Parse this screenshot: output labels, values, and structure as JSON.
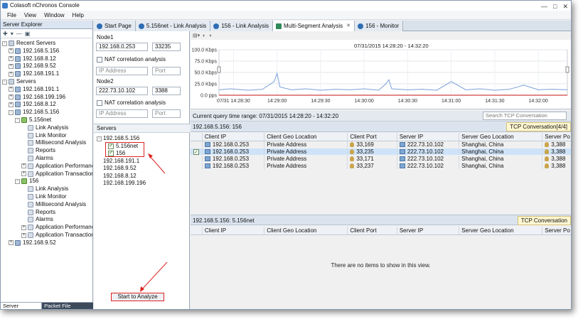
{
  "app": {
    "title": "Colasoft nChronos Console"
  },
  "menu": [
    "File",
    "View",
    "Window",
    "Help"
  ],
  "sidebar": {
    "title": "Server Explorer",
    "tree": [
      {
        "label": "Recent Servers",
        "level": 0,
        "icon": "folder-icon",
        "exp": "-"
      },
      {
        "label": "192.168.5.156",
        "level": 1,
        "icon": "server-icon",
        "exp": "+"
      },
      {
        "label": "192.168.8.12",
        "level": 1,
        "icon": "server-icon",
        "exp": "+"
      },
      {
        "label": "192.168.9.52",
        "level": 1,
        "icon": "server-icon",
        "exp": "+"
      },
      {
        "label": "192.168.191.1",
        "level": 1,
        "icon": "server-icon",
        "exp": "+"
      },
      {
        "label": "Servers",
        "level": 0,
        "icon": "folder-icon",
        "exp": "-"
      },
      {
        "label": "192.168.191.1",
        "level": 1,
        "icon": "server-icon",
        "exp": "+"
      },
      {
        "label": "192.168.199.196",
        "level": 1,
        "icon": "server-icon",
        "exp": "+"
      },
      {
        "label": "192.168.8.12",
        "level": 1,
        "icon": "server-icon",
        "exp": "+"
      },
      {
        "label": "192.168.5.156",
        "level": 1,
        "icon": "server-icon",
        "exp": "-"
      },
      {
        "label": "5.156net",
        "level": 2,
        "icon": "network-icon",
        "exp": "-"
      },
      {
        "label": "Link Analysis",
        "level": 3,
        "icon": "function-icon",
        "exp": ""
      },
      {
        "label": "Link Monitor",
        "level": 3,
        "icon": "function-icon",
        "exp": ""
      },
      {
        "label": "Millisecond Analysis",
        "level": 3,
        "icon": "function-icon",
        "exp": ""
      },
      {
        "label": "Reports",
        "level": 3,
        "icon": "function-icon",
        "exp": ""
      },
      {
        "label": "Alarms",
        "level": 3,
        "icon": "function-icon",
        "exp": ""
      },
      {
        "label": "Application Performance",
        "level": 3,
        "icon": "function-icon",
        "exp": "+"
      },
      {
        "label": "Application Transaction A",
        "level": 3,
        "icon": "function-icon",
        "exp": "+"
      },
      {
        "label": "156",
        "level": 2,
        "icon": "network-icon",
        "exp": "-"
      },
      {
        "label": "Link Analysis",
        "level": 3,
        "icon": "function-icon",
        "exp": ""
      },
      {
        "label": "Link Monitor",
        "level": 3,
        "icon": "function-icon",
        "exp": ""
      },
      {
        "label": "Millisecond Analysis",
        "level": 3,
        "icon": "function-icon",
        "exp": ""
      },
      {
        "label": "Reports",
        "level": 3,
        "icon": "function-icon",
        "exp": ""
      },
      {
        "label": "Alarms",
        "level": 3,
        "icon": "function-icon",
        "exp": ""
      },
      {
        "label": "Application Performance",
        "level": 3,
        "icon": "function-icon",
        "exp": "+"
      },
      {
        "label": "Application Transaction A",
        "level": 3,
        "icon": "function-icon",
        "exp": "+"
      },
      {
        "label": "192.168.9.52",
        "level": 1,
        "icon": "server-icon",
        "exp": "+"
      }
    ],
    "bottom_tabs": [
      "Server Explorer",
      "Packet File Explorer"
    ]
  },
  "tabs": [
    {
      "label": "Start Page",
      "active": false,
      "closable": false
    },
    {
      "label": "5.156net - Link Analysis",
      "active": false,
      "closable": false
    },
    {
      "label": "156 - Link Analysis",
      "active": false,
      "closable": false
    },
    {
      "label": "Multi-Segment Analysis",
      "active": true,
      "closable": true
    },
    {
      "label": "156 - Monitor",
      "active": false,
      "closable": false
    }
  ],
  "nodes": {
    "node1_label": "Node1",
    "node1_ip": "192.168.0.253",
    "node1_port": "33235",
    "node2_label": "Node2",
    "node2_ip": "222.73.10.102",
    "node2_port": "3388",
    "nat_label": "NAT correlation analysis",
    "ip_placeholder": "IP Address",
    "port_placeholder": "Port"
  },
  "servers_panel": {
    "title": "Servers",
    "items": [
      {
        "label": "192.168.5.156",
        "level": 0,
        "exp": "-",
        "checked": null
      },
      {
        "label": "5.156net",
        "level": 1,
        "exp": "",
        "checked": true
      },
      {
        "label": "156",
        "level": 1,
        "exp": "",
        "checked": true
      },
      {
        "label": "192.168.191.1",
        "level": 0,
        "exp": "",
        "checked": null
      },
      {
        "label": "192.168.9.52",
        "level": 0,
        "exp": "",
        "checked": null
      },
      {
        "label": "192.168.8.12",
        "level": 0,
        "exp": "",
        "checked": null
      },
      {
        "label": "192.168.199.196",
        "level": 0,
        "exp": "",
        "checked": null
      }
    ],
    "analyze_button": "Start to Analyze"
  },
  "chart_data": {
    "type": "line",
    "title": "07/31/2015  14:28:20 - 14:32:20",
    "y_ticks": [
      "100.0 Kbps",
      "75.0 Kbps",
      "50.0 Kbps",
      "25.0 Kbps",
      "0.0 pps"
    ],
    "x_ticks": [
      "07/31 14:28:30",
      "14:29:00",
      "14:29:30",
      "14:30:00",
      "14:30:30",
      "14:31:00",
      "14:31:30",
      "14:32:00"
    ],
    "ylim": [
      0,
      100
    ],
    "x_seconds_range": [
      0,
      240
    ],
    "series": [
      {
        "name": "192.168.5.156: 156",
        "color": "#7aa0d8",
        "x": [
          0,
          8,
          20,
          30,
          38,
          40,
          42,
          50,
          60,
          70,
          80,
          90,
          100,
          110,
          115,
          117,
          119,
          130,
          140,
          150,
          160,
          170,
          180,
          190,
          200,
          210,
          220,
          230,
          240
        ],
        "y": [
          12,
          14,
          11,
          13,
          30,
          48,
          18,
          12,
          14,
          11,
          13,
          12,
          14,
          11,
          25,
          34,
          14,
          12,
          13,
          11,
          30,
          12,
          14,
          11,
          13,
          22,
          12,
          13,
          12
        ]
      },
      {
        "name": "192.168.5.156: 5.156net",
        "color": "#d04040",
        "x": [
          0,
          60,
          120,
          180,
          240
        ],
        "y": [
          0,
          0,
          0,
          0,
          0
        ]
      }
    ]
  },
  "query": {
    "range_text": "Current query time range: 07/31/2015 14:28:20 - 14:32:20",
    "search_placeholder": "Search TCP Conversation"
  },
  "upper_section": {
    "title": "192.168.5.156: 156",
    "badge": "TCP Conversation[4/4]",
    "columns": [
      "Client IP",
      "Client Geo Location",
      "Client Port",
      "Server IP",
      "Server Geo Location",
      "Server Po"
    ],
    "rows": [
      {
        "client_ip": "192.168.0.253",
        "client_geo": "Private Address",
        "client_port": "33,169",
        "server_ip": "222.73.10.102",
        "server_geo": "Shanghai, China",
        "server_port": "3,388",
        "selected": false
      },
      {
        "client_ip": "192.168.0.253",
        "client_geo": "Private Address",
        "client_port": "33,235",
        "server_ip": "222.73.10.102",
        "server_geo": "Shanghai, China",
        "server_port": "3,388",
        "selected": true
      },
      {
        "client_ip": "192.168.0.253",
        "client_geo": "Private Address",
        "client_port": "33,171",
        "server_ip": "222.73.10.102",
        "server_geo": "Shanghai, China",
        "server_port": "3,388",
        "selected": false
      },
      {
        "client_ip": "192.168.0.253",
        "client_geo": "Private Address",
        "client_port": "33,237",
        "server_ip": "222.73.10.102",
        "server_geo": "Shanghai, China",
        "server_port": "3,388",
        "selected": false
      }
    ]
  },
  "lower_section": {
    "title": "192.168.5.156: 5.156net",
    "badge": "TCP Conversation",
    "empty_text": "There are no items to show in this view."
  }
}
